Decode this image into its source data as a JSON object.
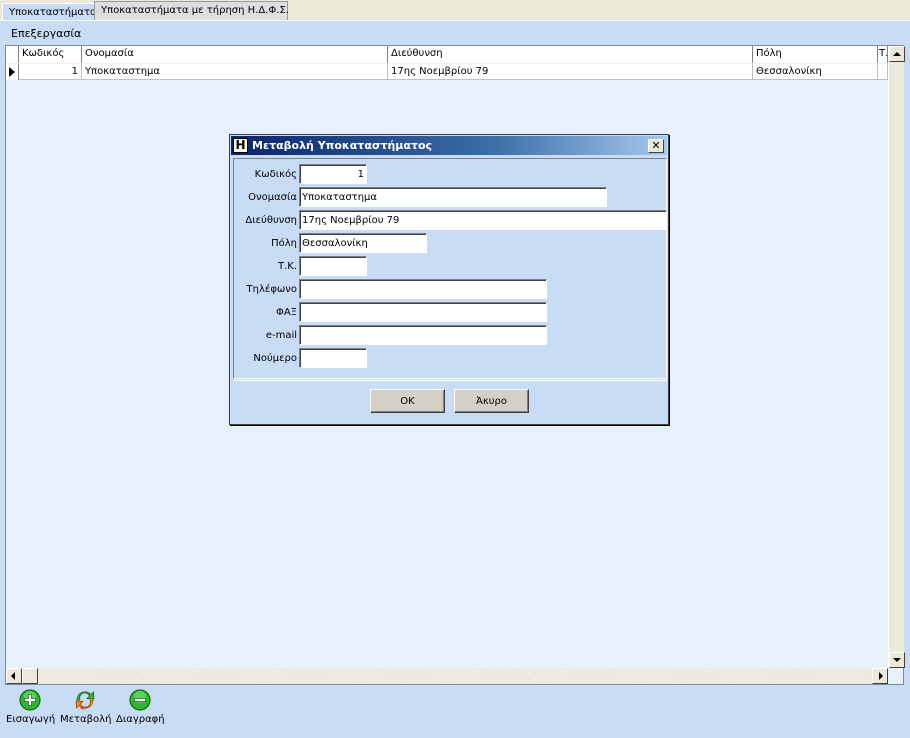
{
  "tabs": [
    {
      "label": "Υποκαταστήματα",
      "active": false
    },
    {
      "label": "Υποκαταστήματα με τήρηση Η.Δ.Φ.Σ.",
      "active": true
    }
  ],
  "menu": {
    "edit_label": "Επεξεργασία"
  },
  "grid": {
    "columns": [
      "Κωδικός",
      "Ονομασία",
      "Διεύθυνση",
      "Πόλη",
      "Τ."
    ],
    "rows": [
      {
        "code": "1",
        "name": "Υποκαταστημα",
        "address": "17ης Νοεμβρίου 79",
        "city": "Θεσσαλονίκη"
      }
    ]
  },
  "toolbar": {
    "insert_label": "Εισαγωγή",
    "modify_label": "Μεταβολή",
    "delete_label": "Διαγραφή"
  },
  "dialog": {
    "title": "Μεταβολή Υποκαταστήματος",
    "icon_letter": "Η",
    "close_glyph": "✕",
    "fields": {
      "code": {
        "label": "Κωδικός",
        "value": "1"
      },
      "name": {
        "label": "Ονομασία",
        "value": "Υποκαταστημα"
      },
      "address": {
        "label": "Διεύθυνση",
        "value": "17ης Νοεμβρίου 79"
      },
      "city": {
        "label": "Πόλη",
        "value": "Θεσσαλονίκη"
      },
      "postal": {
        "label": "Τ.Κ.",
        "value": ""
      },
      "phone": {
        "label": "Τηλέφωνο",
        "value": ""
      },
      "fax": {
        "label": "ΦΑΞ",
        "value": ""
      },
      "email": {
        "label": "e-mail",
        "value": ""
      },
      "number": {
        "label": "Νούμερο",
        "value": ""
      }
    },
    "ok_label": "OK",
    "cancel_label": "Άκυρο"
  },
  "colors": {
    "background": "#c9dcf6",
    "title_start": "#0a246a",
    "title_end": "#a6caf0"
  }
}
